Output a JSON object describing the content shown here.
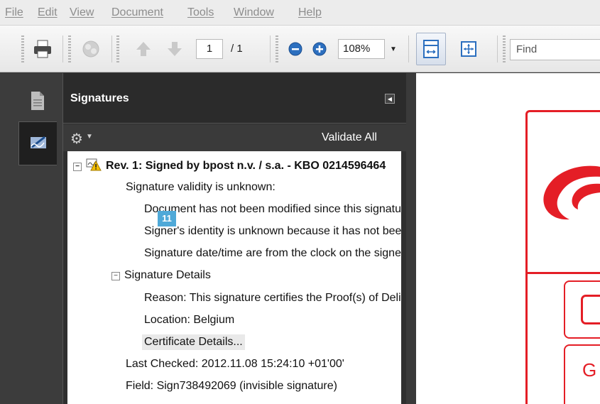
{
  "menu": [
    "File",
    "Edit",
    "View",
    "Document",
    "Tools",
    "Window",
    "Help"
  ],
  "toolbar": {
    "icons": [
      "print-icon",
      "share-icon",
      "prev-page-icon",
      "next-page-icon",
      "zoom-out-icon",
      "zoom-in-icon",
      "fit-width-icon",
      "fit-page-icon",
      "zoom-dropdown-icon"
    ],
    "page_current": "1",
    "page_total": "/ 1",
    "zoom": "108%",
    "find_placeholder": "Find"
  },
  "left_strip": {
    "icons": [
      "pages-icon",
      "signatures-icon"
    ]
  },
  "panel": {
    "title": "Signatures",
    "validate_all": "Validate All",
    "tree": {
      "rev_title": "Rev. 1: Signed by bpost n.v. / s.a. - KBO 0214596464",
      "validity": "Signature validity is unknown:",
      "not_modified": "Document has not been modified since this signature was applied",
      "identity_unknown": "Signer's identity is unknown because it has not been included in your list of trusted certificates",
      "date_time": "Signature date/time are from the clock on the signer's computer.",
      "details_header": "Signature Details",
      "reason": "Reason: This signature certifies the Proof(s) of Delivery",
      "location": "Location: Belgium",
      "cert_details": "Certificate Details...",
      "last_checked": "Last Checked: 2012.11.08 15:24:10 +01'00'",
      "field": "Field: Sign738492069 (invisible signature)"
    },
    "badge": "11"
  },
  "document": {
    "letter": "G"
  },
  "colors": {
    "brand_red": "#e41e26",
    "badge_blue": "#4fa9d8",
    "panel_bg": "#2f2f2f"
  }
}
